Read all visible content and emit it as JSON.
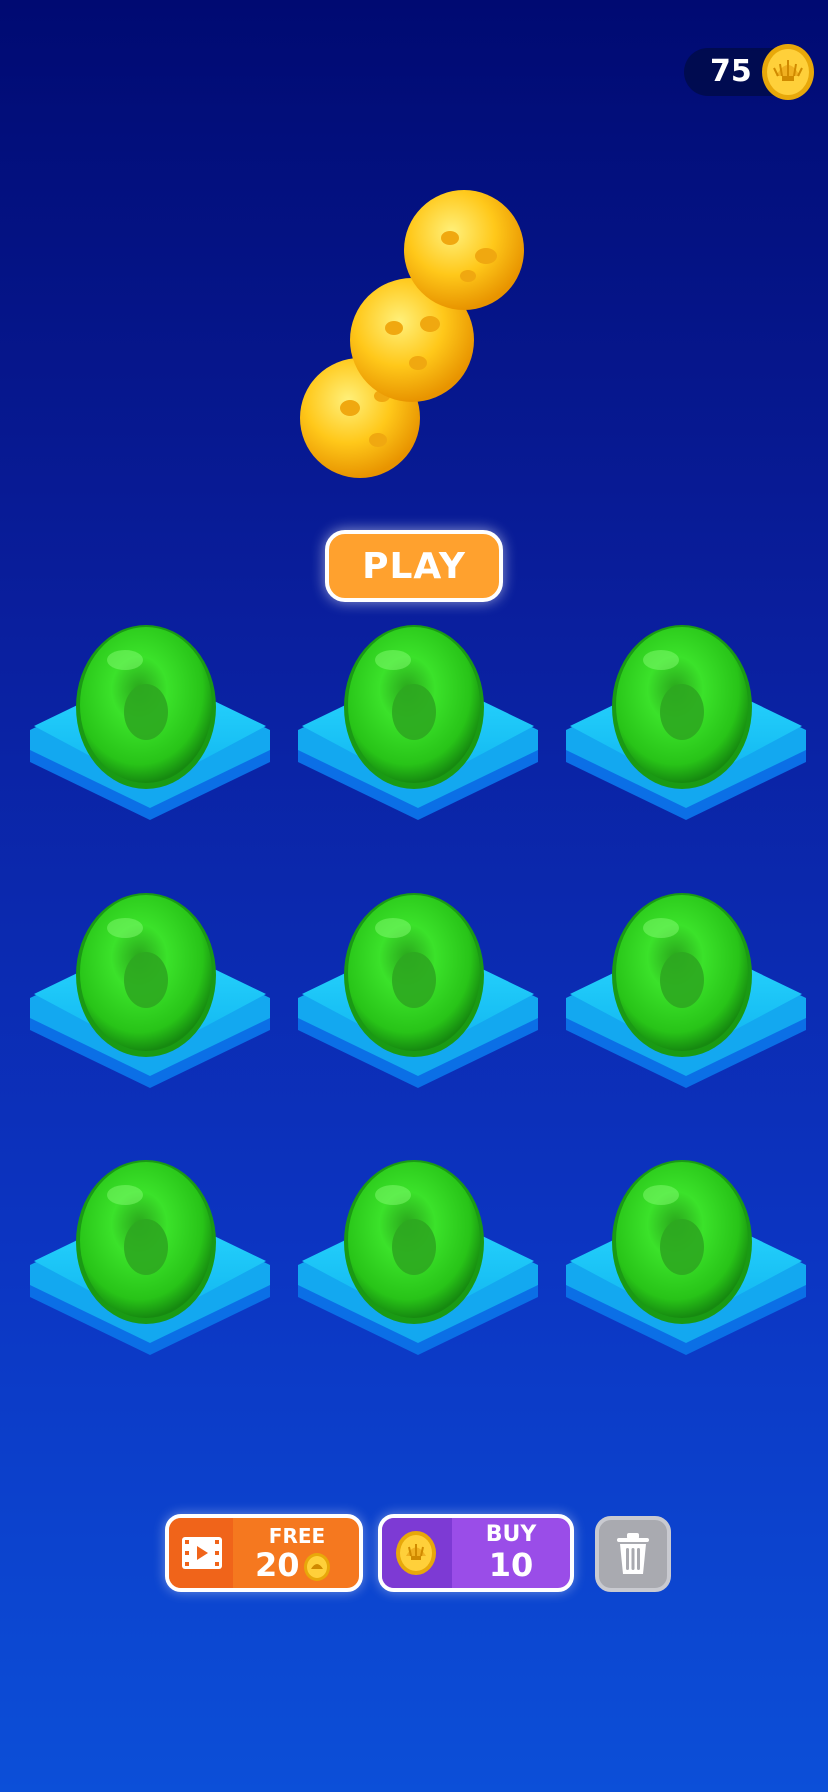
{
  "hud": {
    "coins": "75",
    "coin_icon": "shell-coin-icon"
  },
  "player": {
    "description_icon": "yellow-ball-snake-icon",
    "segments": 3,
    "color": "#ffc21a"
  },
  "play_button": {
    "label": "PLAY",
    "color": "#ffa12e"
  },
  "grid": {
    "rows": 3,
    "cols": 3,
    "slots": [
      {
        "item": "green-egg-icon"
      },
      {
        "item": "green-egg-icon"
      },
      {
        "item": "green-egg-icon"
      },
      {
        "item": "green-egg-icon"
      },
      {
        "item": "green-egg-icon"
      },
      {
        "item": "green-egg-icon"
      },
      {
        "item": "green-egg-icon"
      },
      {
        "item": "green-egg-icon"
      },
      {
        "item": "green-egg-icon"
      }
    ],
    "egg_color": "#2fd61c",
    "tile_color": "#19c6f5"
  },
  "bottom": {
    "free": {
      "label": "FREE",
      "value": "20",
      "icon": "video-ad-icon",
      "color": "#f5781f"
    },
    "buy": {
      "label": "BUY",
      "value": "10",
      "icon": "shell-coin-icon",
      "color": "#9a4de8"
    },
    "trash": {
      "icon": "trash-icon",
      "color": "#a9aab0"
    }
  }
}
